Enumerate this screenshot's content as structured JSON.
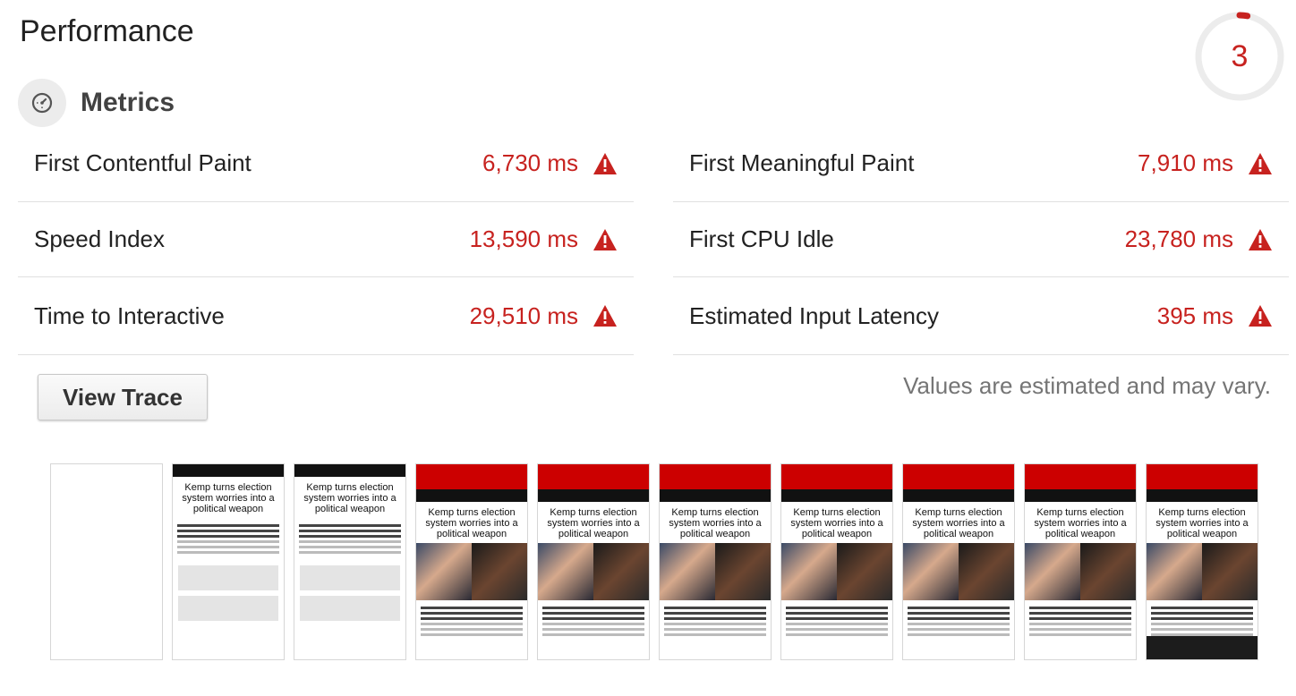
{
  "page_title": "Performance",
  "score": "3",
  "score_fraction": 0.03,
  "metrics_title": "Metrics",
  "metrics": {
    "left": [
      {
        "label": "First Contentful Paint",
        "value": "6,730 ms"
      },
      {
        "label": "Speed Index",
        "value": "13,590 ms"
      },
      {
        "label": "Time to Interactive",
        "value": "29,510 ms"
      }
    ],
    "right": [
      {
        "label": "First Meaningful Paint",
        "value": "7,910 ms"
      },
      {
        "label": "First CPU Idle",
        "value": "23,780 ms"
      },
      {
        "label": "Estimated Input Latency",
        "value": "395 ms"
      }
    ]
  },
  "view_trace_label": "View Trace",
  "estimate_note": "Values are estimated and may vary.",
  "filmstrip": {
    "headline": "Kemp turns election system worries into a political weapon",
    "frames": [
      "blank",
      "loading",
      "loading",
      "loaded",
      "loaded",
      "loaded",
      "loaded",
      "loaded",
      "loaded",
      "loaded-banner"
    ]
  },
  "colors": {
    "fail": "#c7221f",
    "gauge_track": "#ececec"
  },
  "icons": {
    "metrics": "stopwatch-icon",
    "status": "warning-triangle-icon"
  }
}
